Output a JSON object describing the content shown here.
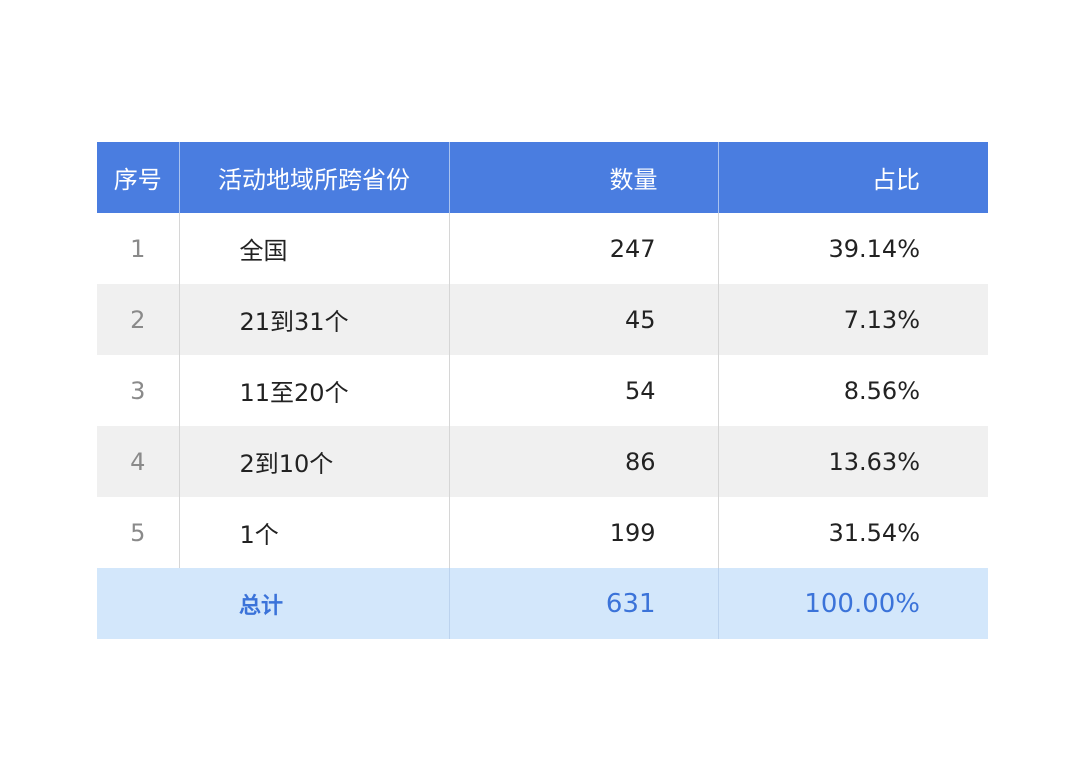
{
  "chart_data": {
    "type": "table",
    "columns": [
      "序号",
      "活动地域所跨省份",
      "数量",
      "占比"
    ],
    "rows": [
      {
        "index": "1",
        "range": "全国",
        "count": "247",
        "share": "39.14%"
      },
      {
        "index": "2",
        "range": "21到31个",
        "count": "45",
        "share": "7.13%"
      },
      {
        "index": "3",
        "range": "11至20个",
        "count": "54",
        "share": "8.56%"
      },
      {
        "index": "4",
        "range": "2到10个",
        "count": "86",
        "share": "13.63%"
      },
      {
        "index": "5",
        "range": "1个",
        "count": "199",
        "share": "31.54%"
      }
    ],
    "total": {
      "label": "总计",
      "count": "631",
      "share": "100.00%"
    }
  },
  "colors": {
    "header_bg": "#4a7de0",
    "header_text": "#ffffff",
    "stripe_bg": "#f0f0f0",
    "total_bg": "#d3e7fb",
    "total_text": "#3b73d9"
  }
}
